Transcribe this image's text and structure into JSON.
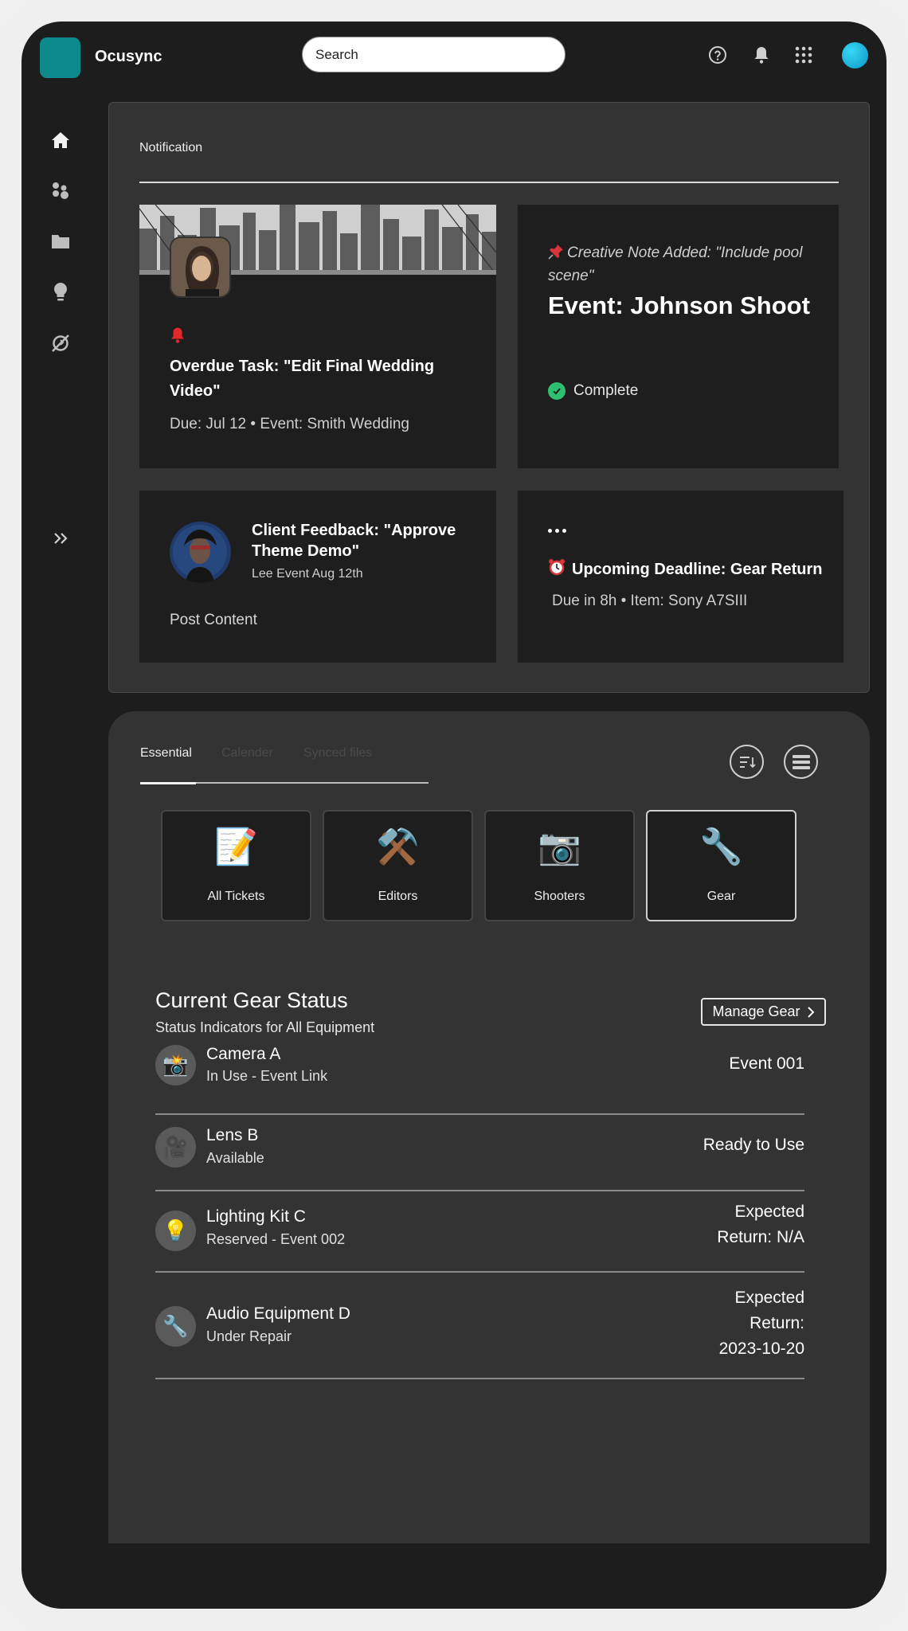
{
  "app": {
    "name": "Ocusync"
  },
  "search": {
    "placeholder": "Search"
  },
  "notifications": {
    "title": "Notification",
    "card1": {
      "title": "Overdue Task: \"Edit Final Wedding Video\"",
      "meta": "Due: Jul 12 • Event: Smith Wedding"
    },
    "card2": {
      "note": "Creative Note Added: \"Include pool scene\"",
      "title": "Event: Johnson Shoot",
      "status": "Complete"
    },
    "card3": {
      "title": "Client Feedback: \"Approve Theme Demo\"",
      "sub": "Lee Event Aug 12th",
      "post": "Post Content"
    },
    "card4": {
      "title": "Upcoming Deadline: Gear Return",
      "meta": "Due in 8h • Item: Sony A7SIII"
    }
  },
  "tabs": [
    {
      "label": "Essential"
    },
    {
      "label": "Calender"
    },
    {
      "label": "Synced files"
    }
  ],
  "categories": [
    {
      "label": "All Tickets",
      "icon": "📝"
    },
    {
      "label": "Editors",
      "icon": "⚒️"
    },
    {
      "label": "Shooters",
      "icon": "📷"
    },
    {
      "label": "Gear",
      "icon": "🔧"
    }
  ],
  "gear_status": {
    "title": "Current Gear Status",
    "subtitle": "Status Indicators for All Equipment",
    "manage_label": "Manage Gear",
    "items": [
      {
        "name": "Camera A",
        "status": "In Use - Event Link",
        "right": "Event 001",
        "icon": "📸"
      },
      {
        "name": "Lens B",
        "status": "Available",
        "right": "Ready to Use",
        "icon": "🎥"
      },
      {
        "name": "Lighting Kit C",
        "status": "Reserved - Event 002",
        "right_lines": [
          "Expected",
          "Return: N/A"
        ],
        "icon": "💡"
      },
      {
        "name": "Audio Equipment D",
        "status": "Under Repair",
        "right_lines": [
          "Expected",
          "Return:",
          "2023-10-20"
        ],
        "icon": "🔧"
      }
    ]
  },
  "colors": {
    "accent": "#0d8a8c",
    "complete": "#2fbf71",
    "alert": "#e5262b"
  }
}
